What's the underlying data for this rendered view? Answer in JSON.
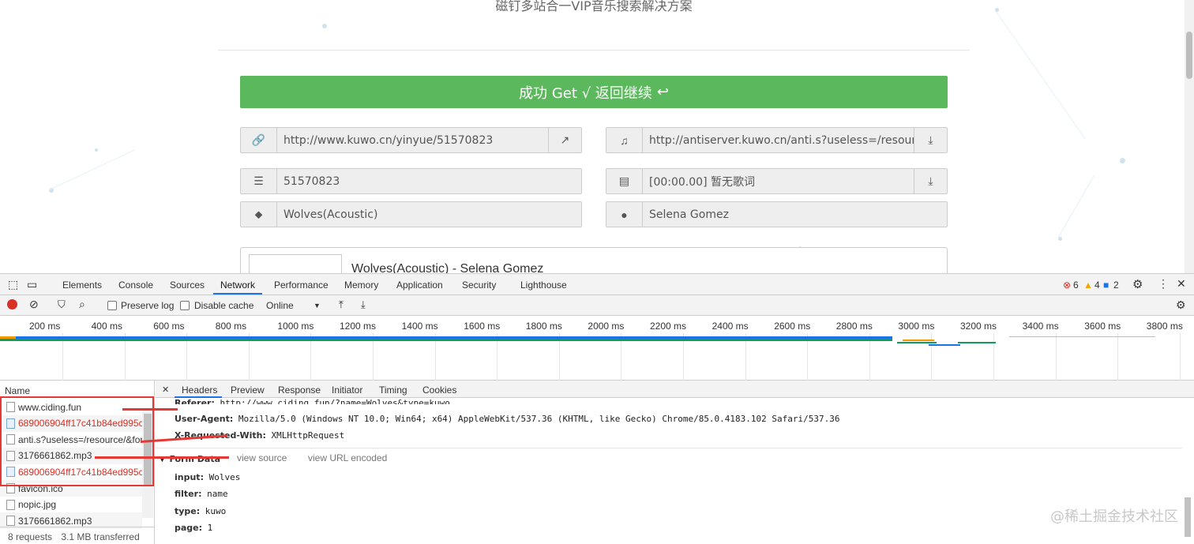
{
  "page": {
    "subtitle": "磁钉多站合一VIP音乐搜索解决方案",
    "success_button": "成功 Get √ 返回继续",
    "fields": {
      "url": "http://www.kuwo.cn/yinyue/51570823",
      "audio_url": "http://antiserver.kuwo.cn/anti.s?useless=/resource/...",
      "song_id": "51570823",
      "lyrics": "[00:00.00] 暂无歌词",
      "title": "Wolves(Acoustic)",
      "artist": "Selena Gomez"
    },
    "player_title": "Wolves(Acoustic) - Selena Gomez"
  },
  "devtools": {
    "tabs": [
      "Elements",
      "Console",
      "Sources",
      "Network",
      "Performance",
      "Memory",
      "Application",
      "Security",
      "Lighthouse"
    ],
    "active_tab": "Network",
    "error_count": "6",
    "warning_count": "4",
    "info_count": "2",
    "toolbar": {
      "preserve_log": "Preserve log",
      "disable_cache": "Disable cache",
      "throttle": "Online"
    },
    "timeline_ticks": [
      "200 ms",
      "400 ms",
      "600 ms",
      "800 ms",
      "1000 ms",
      "1200 ms",
      "1400 ms",
      "1600 ms",
      "1800 ms",
      "2000 ms",
      "2200 ms",
      "2400 ms",
      "2600 ms",
      "2800 ms",
      "3000 ms",
      "3200 ms",
      "3400 ms",
      "3600 ms",
      "3800 ms"
    ],
    "name_header": "Name",
    "requests": [
      {
        "name": "www.ciding.fun",
        "type": "doc",
        "red": false
      },
      {
        "name": "689006904ff17c41b84ed995c...",
        "type": "img",
        "red": true
      },
      {
        "name": "anti.s?useless=/resource/&for...",
        "type": "doc",
        "red": false
      },
      {
        "name": "3176661862.mp3",
        "type": "doc",
        "red": false
      },
      {
        "name": "689006904ff17c41b84ed995c...",
        "type": "img",
        "red": true
      },
      {
        "name": "favicon.ico",
        "type": "doc",
        "red": false
      },
      {
        "name": "nopic.jpg",
        "type": "doc",
        "red": false
      },
      {
        "name": "3176661862.mp3",
        "type": "doc",
        "red": false
      }
    ],
    "footer": {
      "requests": "8 requests",
      "transferred": "3.1 MB transferred"
    },
    "detail_tabs": [
      "Headers",
      "Preview",
      "Response",
      "Initiator",
      "Timing",
      "Cookies"
    ],
    "active_detail_tab": "Headers",
    "headers": [
      {
        "key": "Referer:",
        "value": "http://www.ciding.fun/?name=Wolves&type=kuwo"
      },
      {
        "key": "User-Agent:",
        "value": "Mozilla/5.0 (Windows NT 10.0; Win64; x64) AppleWebKit/537.36 (KHTML, like Gecko) Chrome/85.0.4183.102 Safari/537.36"
      },
      {
        "key": "X-Requested-With:",
        "value": "XMLHttpRequest"
      }
    ],
    "form_data": {
      "title": "Form Data",
      "view_source": "view source",
      "view_url_encoded": "view URL encoded",
      "items": [
        {
          "key": "input:",
          "value": "Wolves"
        },
        {
          "key": "filter:",
          "value": "name"
        },
        {
          "key": "type:",
          "value": "kuwo"
        },
        {
          "key": "page:",
          "value": "1"
        }
      ]
    }
  },
  "watermark": "@稀土掘金技术社区"
}
